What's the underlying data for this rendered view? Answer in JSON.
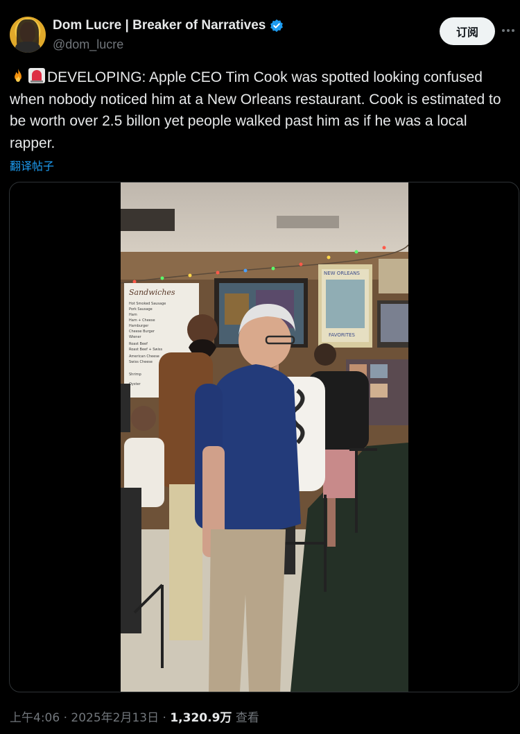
{
  "author": {
    "name": "Dom Lucre | Breaker of Narratives",
    "handle": "@dom_lucre"
  },
  "actions": {
    "subscribe_label": "订阅"
  },
  "tweet": {
    "text": "DEVELOPING: Apple CEO Tim Cook was spotted looking confused when nobody noticed him at a New Orleans restaurant. Cook is estimated to be worth over 2.5 billon yet people walked past him as if he was a local rapper.",
    "leading_emojis": [
      "fire-emoji",
      "siren-emoji"
    ],
    "translate_label": "翻译帖子"
  },
  "media": {
    "poster_title": "NEW ORLEANS",
    "poster_sub": "FAVORITES",
    "menu_title": "Sandwiches",
    "menu_items": [
      "Hot Smoked Sausage",
      "Pork Sausage",
      "Ham",
      "Ham + Cheese",
      "Hamburger",
      "Cheese Burger",
      "Wiener",
      "Roast Beef",
      "Roast Beef + Swiss",
      "American Cheese",
      "Swiss Cheese",
      "Shrimp",
      "Oyster"
    ]
  },
  "meta": {
    "time": "上午4:06",
    "separator": "·",
    "date": "2025年2月13日",
    "views": "1,320.9万",
    "views_label": "查看"
  },
  "colors": {
    "background": "#000000",
    "text": "#e7e9ea",
    "secondary": "#71767b",
    "link": "#1d9bf0",
    "verified": "#1d9bf0"
  }
}
